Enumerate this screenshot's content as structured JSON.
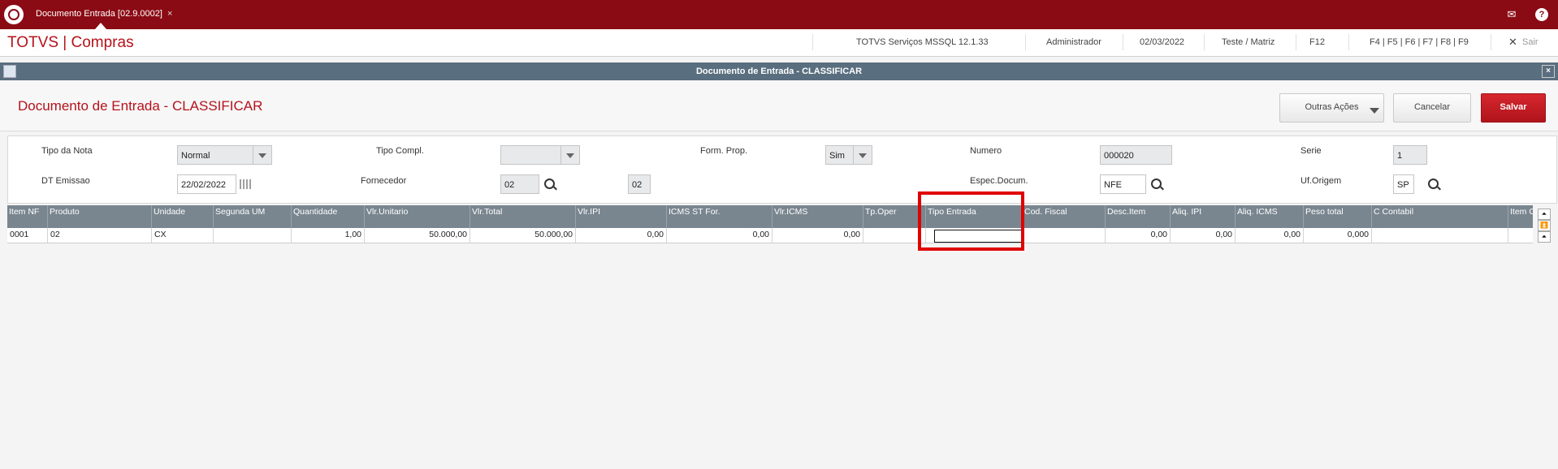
{
  "tab": {
    "label": "Documento Entrada [02.9.0002]",
    "close": "×"
  },
  "top_icons": {
    "mail": "mail-icon",
    "help": "?"
  },
  "app": {
    "title": "TOTVS | Compras"
  },
  "status": {
    "server": "TOTVS Serviços MSSQL 12.1.33",
    "user": "Administrador",
    "date": "02/03/2022",
    "branch": "Teste / Matriz",
    "f12": "F12",
    "fkeys": "F4 | F5 | F6 | F7 | F8 | F9",
    "exit_icon": "✕",
    "exit": "Sair"
  },
  "dialog": {
    "window_title": "Documento de Entrada - CLASSIFICAR",
    "heading": "Documento de Entrada - CLASSIFICAR",
    "close": "×",
    "buttons": {
      "outras": "Outras Ações",
      "cancelar": "Cancelar",
      "salvar": "Salvar"
    }
  },
  "form": {
    "tipo_nota": {
      "label": "Tipo da Nota",
      "value": "Normal"
    },
    "tipo_compl": {
      "label": "Tipo Compl.",
      "value": ""
    },
    "form_prop": {
      "label": "Form. Prop.",
      "value": "Sim"
    },
    "numero": {
      "label": "Numero",
      "value": "000020"
    },
    "serie": {
      "label": "Serie",
      "value": "1"
    },
    "dt_emissao": {
      "label": "DT Emissao",
      "value": "22/02/2022"
    },
    "fornecedor": {
      "label": "Fornecedor",
      "value": "02",
      "loja": "02"
    },
    "espec_docum": {
      "label": "Espec.Docum.",
      "value": "NFE"
    },
    "uf_origem": {
      "label": "Uf.Origem",
      "value": "SP"
    }
  },
  "grid": {
    "columns": [
      "Item NF",
      "Produto",
      "Unidade",
      "Segunda UM",
      "Quantidade",
      "Vlr.Unitario",
      "Vlr.Total",
      "Vlr.IPI",
      "ICMS ST For.",
      "Vlr.ICMS",
      "Tp.Oper",
      "Tipo Entrada",
      "Cod. Fiscal",
      "Desc.Item",
      "Aliq. IPI",
      "Aliq. ICMS",
      "Peso total",
      "C Contabil",
      "Item Conta"
    ],
    "rows": [
      [
        "0001",
        "02",
        "CX",
        "",
        "1,00",
        "50.000,00",
        "50.000,00",
        "0,00",
        "0,00",
        "0,00",
        "",
        "",
        "",
        "0,00",
        "0,00",
        "0,00",
        "0,000",
        "",
        ""
      ]
    ]
  },
  "scroll_buttons": [
    "⏶",
    "⏫",
    "⏶"
  ]
}
